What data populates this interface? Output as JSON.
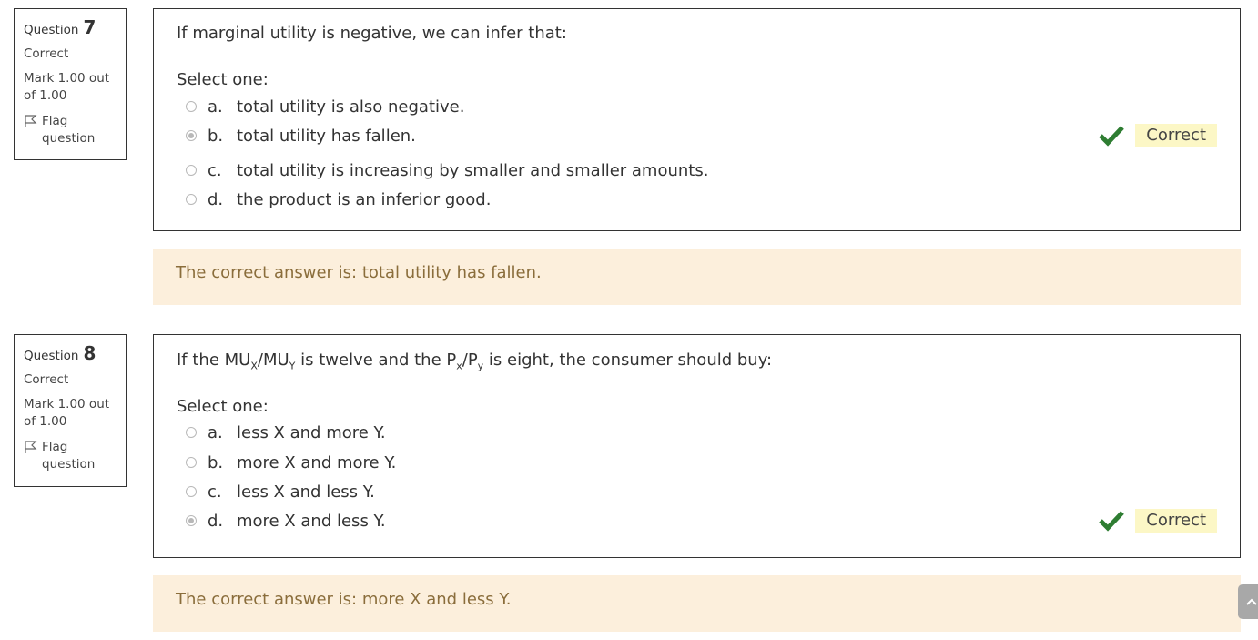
{
  "questions": [
    {
      "number_label": "Question",
      "number": "7",
      "state": "Correct",
      "grade": "Mark 1.00 out of 1.00",
      "flag_label": "Flag question",
      "text": "If marginal utility is negative, we can infer that:",
      "prompt": "Select one:",
      "answers": [
        {
          "letter": "a.",
          "text": "total utility is also negative.",
          "checked": false
        },
        {
          "letter": "b.",
          "text": "total utility has fallen.",
          "checked": true
        },
        {
          "letter": "c.",
          "text": "total utility is increasing by smaller and smaller amounts.",
          "checked": false
        },
        {
          "letter": "d.",
          "text": "the product is an inferior good.",
          "checked": false
        }
      ],
      "result_label": "Correct",
      "feedback": "The correct answer is: total utility has fallen."
    },
    {
      "number_label": "Question",
      "number": "8",
      "state": "Correct",
      "grade": "Mark 1.00 out of 1.00",
      "flag_label": "Flag question",
      "text_parts": {
        "p1": "If the MU",
        "sub1": "X",
        "p2": "/MU",
        "sub2": "Y",
        "p3": " is twelve and the P",
        "sub3": "x",
        "p4": "/P",
        "sub4": "y",
        "p5": " is eight, the consumer should buy:"
      },
      "prompt": "Select one:",
      "answers": [
        {
          "letter": "a.",
          "text": "less X and more Y.",
          "checked": false
        },
        {
          "letter": "b.",
          "text": "more X and more Y.",
          "checked": false
        },
        {
          "letter": "c.",
          "text": "less X and less Y.",
          "checked": false
        },
        {
          "letter": "d.",
          "text": "more X and less Y.",
          "checked": true
        }
      ],
      "result_label": "Correct",
      "feedback": "The correct answer is: more X and less Y."
    }
  ],
  "colors": {
    "correct_check": "#2e7d32",
    "correct_label_bg": "#fcf7c6",
    "feedback_bg": "#fcefdc",
    "feedback_text": "#8a6d3b"
  },
  "icons": {
    "flag": "flag-icon",
    "check": "check-icon",
    "scroll_top": "chevron-up-icon"
  }
}
